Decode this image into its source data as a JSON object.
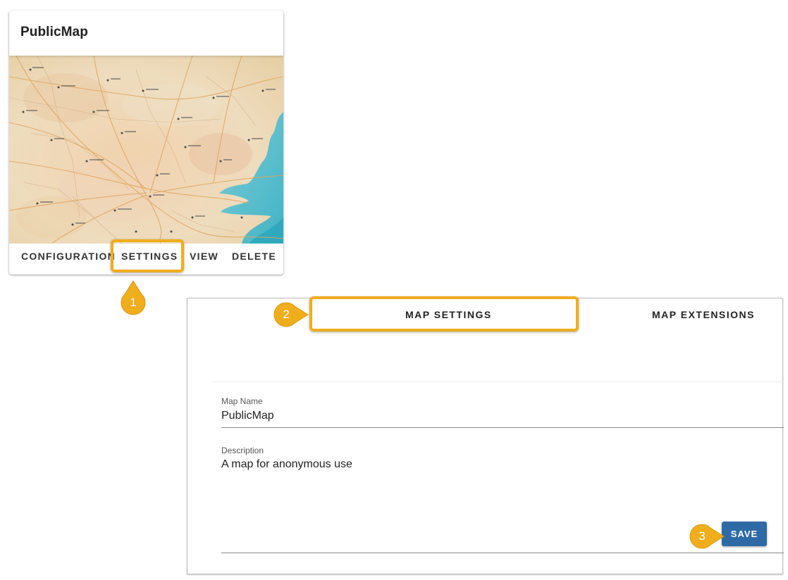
{
  "card": {
    "title": "PublicMap",
    "thumbnail_icon": "map-thumbnail",
    "actions": {
      "configuration": "CONFIGURATION",
      "settings": "SETTINGS",
      "view": "VIEW",
      "delete": "DELETE"
    }
  },
  "callouts": {
    "step1": "1",
    "step2": "2",
    "step3": "3",
    "color": "#f0ad1c"
  },
  "panel": {
    "tabs": {
      "map_settings": "MAP SETTINGS",
      "map_extensions": "MAP EXTENSIONS"
    },
    "fields": {
      "map_name_label": "Map Name",
      "map_name_value": "PublicMap",
      "description_label": "Description",
      "description_value": "A map for anonymous use"
    },
    "save_label": "SAVE",
    "save_color": "#2e6aa5"
  }
}
